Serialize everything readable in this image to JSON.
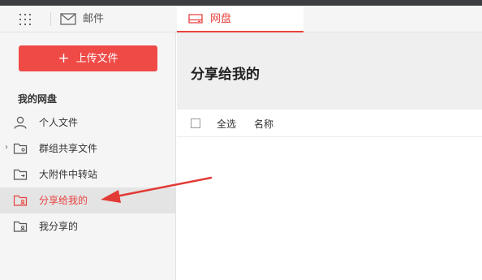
{
  "topbar": {
    "app_label": "邮件",
    "active_tab": "网盘"
  },
  "sidebar": {
    "upload_button": "上传文件",
    "section_title": "我的网盘",
    "items": [
      {
        "label": "个人文件",
        "icon": "person-icon"
      },
      {
        "label": "群组共享文件",
        "icon": "group-folder-icon",
        "expandable": true
      },
      {
        "label": "大附件中转站",
        "icon": "transfer-folder-icon"
      },
      {
        "label": "分享给我的",
        "icon": "shared-to-me-icon",
        "active": true
      },
      {
        "label": "我分享的",
        "icon": "my-shares-icon"
      }
    ]
  },
  "main": {
    "page_title": "分享给我的",
    "columns": {
      "select_all": "全选",
      "name": "名称"
    }
  },
  "colors": {
    "accent": "#e8423f",
    "upload_button": "#ef4a46",
    "arrow": "#e23a35"
  }
}
